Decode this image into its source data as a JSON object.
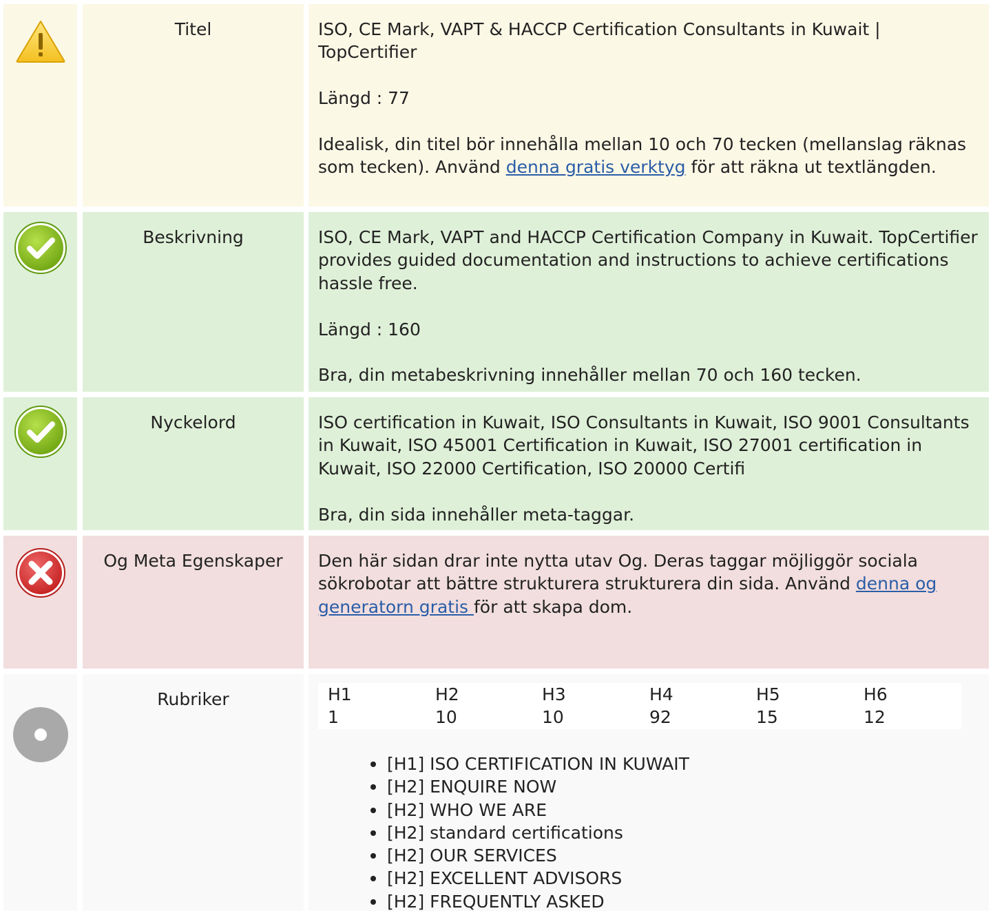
{
  "title_row": {
    "label": "Titel",
    "value": "ISO, CE Mark, VAPT & HACCP Certification Consultants in Kuwait | TopCertifier",
    "length": "Längd : 77",
    "advice_before": "Idealisk, din titel bör innehålla mellan 10 och 70 tecken (mellanslag räknas som tecken). Använd ",
    "advice_link": "denna gratis verktyg",
    "advice_after": " för att räkna ut textlängden.",
    "status_icon": "warning-icon"
  },
  "description_row": {
    "label": "Beskrivning",
    "value": "ISO, CE Mark, VAPT and HACCP Certification Company in Kuwait. TopCertifier provides guided documentation and instructions to achieve certifications hassle free.",
    "length": "Längd : 160",
    "advice": "Bra, din metabeskrivning innehåller mellan 70 och 160 tecken.",
    "status_icon": "check-icon"
  },
  "keywords_row": {
    "label": "Nyckelord",
    "value": "ISO certification in Kuwait, ISO Consultants in Kuwait, ISO 9001 Consultants in Kuwait, ISO 45001 Certification in Kuwait, ISO 27001 certification in Kuwait, ISO 22000 Certification, ISO 20000 Certifi",
    "advice": "Bra, din sida innehåller meta-taggar.",
    "status_icon": "check-icon"
  },
  "og_row": {
    "label": "Og Meta Egenskaper",
    "text_before": "Den här sidan drar inte nytta utav Og. Deras taggar möjliggör sociala sökrobotar att bättre strukturera strukturera din sida. Använd ",
    "link": "denna og generatorn gratis ",
    "text_after": " för att skapa dom.",
    "status_icon": "error-icon"
  },
  "headings_row": {
    "label": "Rubriker",
    "status_icon": "info-icon",
    "counts": [
      {
        "tag": "H1",
        "count": "1"
      },
      {
        "tag": "H2",
        "count": "10"
      },
      {
        "tag": "H3",
        "count": "10"
      },
      {
        "tag": "H4",
        "count": "92"
      },
      {
        "tag": "H5",
        "count": "15"
      },
      {
        "tag": "H6",
        "count": "12"
      }
    ],
    "list": [
      "[H1] ISO CERTIFICATION IN KUWAIT",
      "[H2] ENQUIRE NOW",
      "[H2] WHO WE ARE",
      "[H2] standard certifications",
      "[H2] OUR SERVICES",
      "[H2] EXCELLENT ADVISORS",
      "[H2] FREQUENTLY ASKED"
    ]
  },
  "colors": {
    "warning_bg": "#fcf8e6",
    "success_bg": "#dff0d8",
    "error_bg": "#f2dede",
    "info_bg": "#f9f9f9",
    "link": "#2a5da8"
  }
}
